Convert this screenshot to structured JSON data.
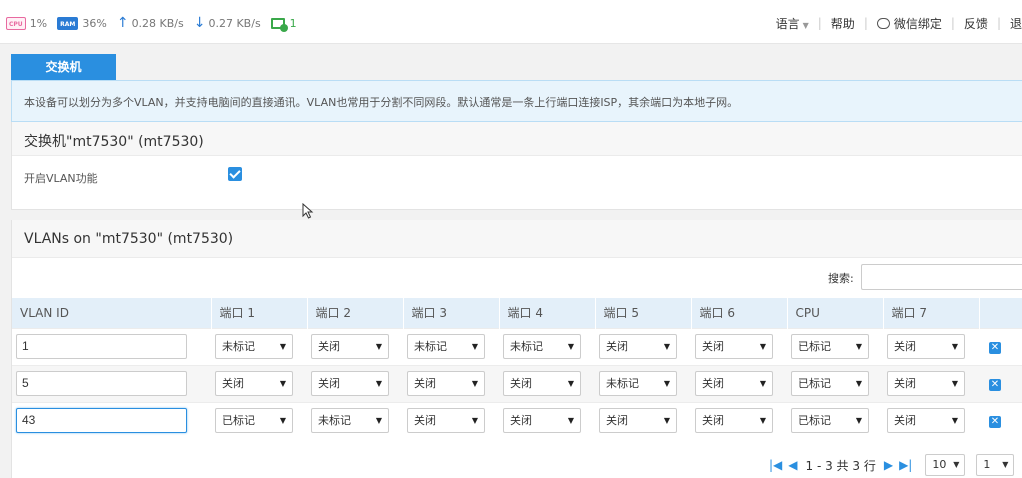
{
  "status": {
    "cpu_chip": "CPU",
    "cpu_value": "1%",
    "ram_chip": "RAM",
    "ram_value": "36%",
    "upload": "0.28 KB/s",
    "download": "0.27 KB/s",
    "clients": "1"
  },
  "nav": {
    "language": "语言",
    "help": "帮助",
    "wechat": "微信绑定",
    "feedback": "反馈",
    "logout": "退"
  },
  "tab": "交换机",
  "info": "本设备可以划分为多个VLAN，并支持电脑间的直接通讯。VLAN也常用于分割不同网段。默认通常是一条上行端口连接ISP，其余端口为本地子网。",
  "switch_section": {
    "title": "交换机\"mt7530\" (mt7530)",
    "enable_vlan_label": "开启VLAN功能",
    "enable_vlan_checked": true
  },
  "vlan_section": {
    "title": "VLANs on \"mt7530\" (mt7530)",
    "search_label": "搜索:",
    "search_value": "",
    "columns": [
      "VLAN ID",
      "端口 1",
      "端口 2",
      "端口 3",
      "端口 4",
      "端口 5",
      "端口 6",
      "CPU",
      "端口 7"
    ],
    "rows": [
      {
        "id": "1",
        "ports": [
          "未标记",
          "关闭",
          "未标记",
          "未标记",
          "关闭",
          "关闭",
          "已标记",
          "关闭"
        ]
      },
      {
        "id": "5",
        "ports": [
          "关闭",
          "关闭",
          "关闭",
          "关闭",
          "未标记",
          "关闭",
          "已标记",
          "关闭"
        ]
      },
      {
        "id": "43",
        "ports": [
          "已标记",
          "未标记",
          "关闭",
          "关闭",
          "关闭",
          "关闭",
          "已标记",
          "关闭"
        ]
      }
    ]
  },
  "pagination": {
    "summary": "1 - 3 共 3 行",
    "page_size": "10",
    "page": "1"
  },
  "icons": {
    "delete": "delete-icon",
    "first": "first-page-icon",
    "prev": "prev-page-icon",
    "next": "next-page-icon",
    "last": "last-page-icon"
  },
  "colors": {
    "accent": "#2a8fe0",
    "header_bg": "#e3eff9",
    "info_bg": "#e8f4fc",
    "network_ok": "#3aa84a"
  }
}
